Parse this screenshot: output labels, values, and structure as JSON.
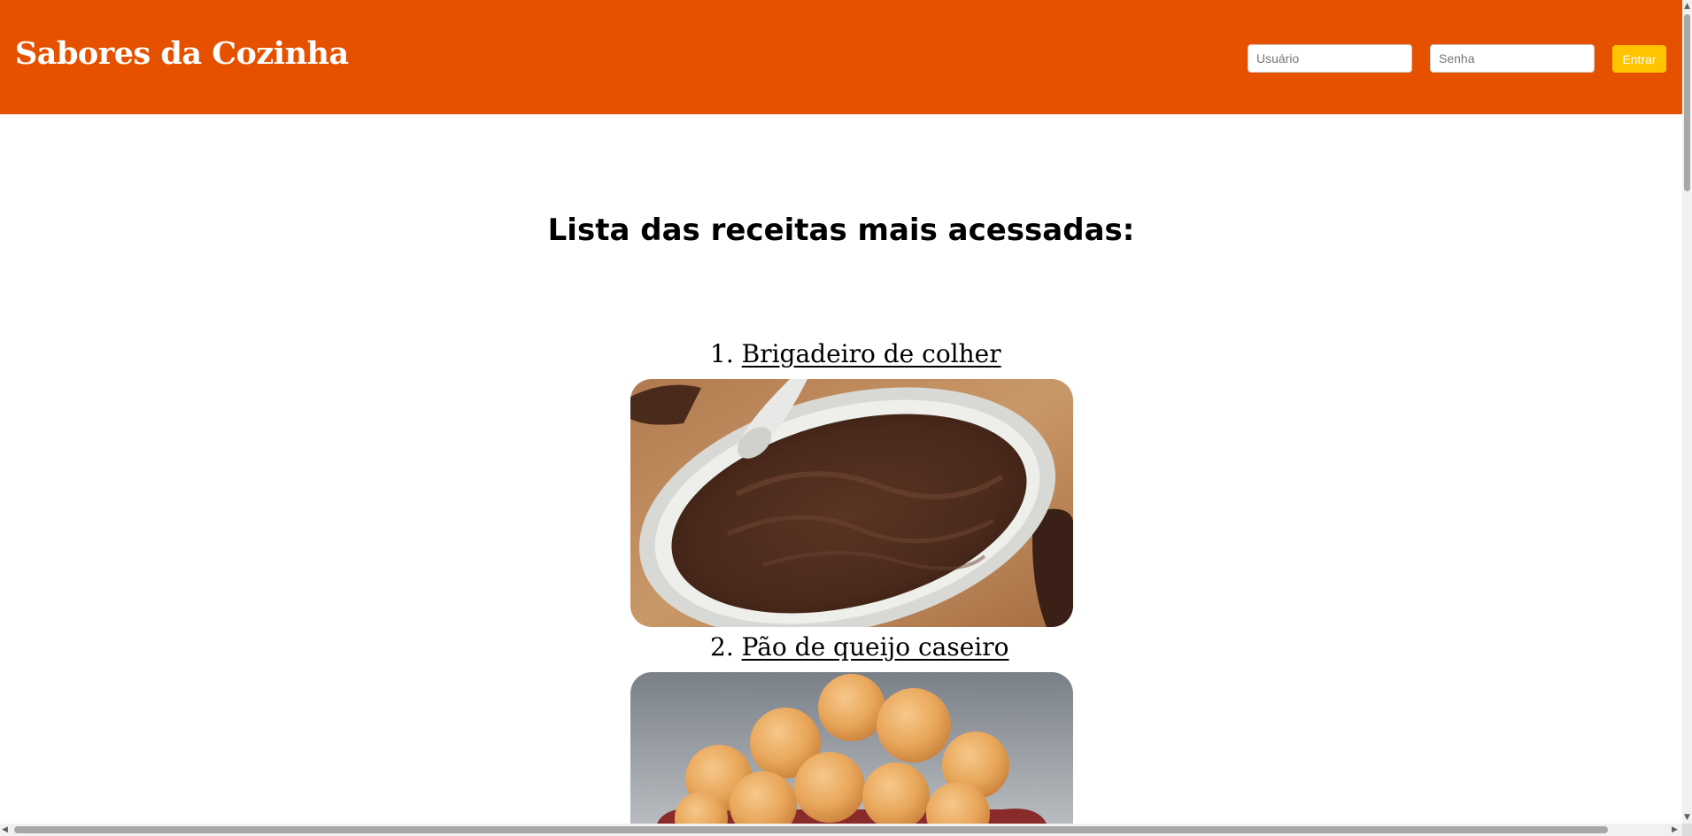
{
  "header": {
    "brand": "Sabores da Cozinha",
    "bg_color": "#e65100",
    "username_placeholder": "Usuário",
    "password_placeholder": "Senha",
    "login_button": "Entrar",
    "login_button_color": "#ffc400"
  },
  "main": {
    "heading": "Lista das receitas mais acessadas:",
    "recipes": [
      {
        "number": "1.",
        "title": "Brigadeiro de colher"
      },
      {
        "number": "2.",
        "title": "Pão de queijo caseiro"
      }
    ]
  }
}
